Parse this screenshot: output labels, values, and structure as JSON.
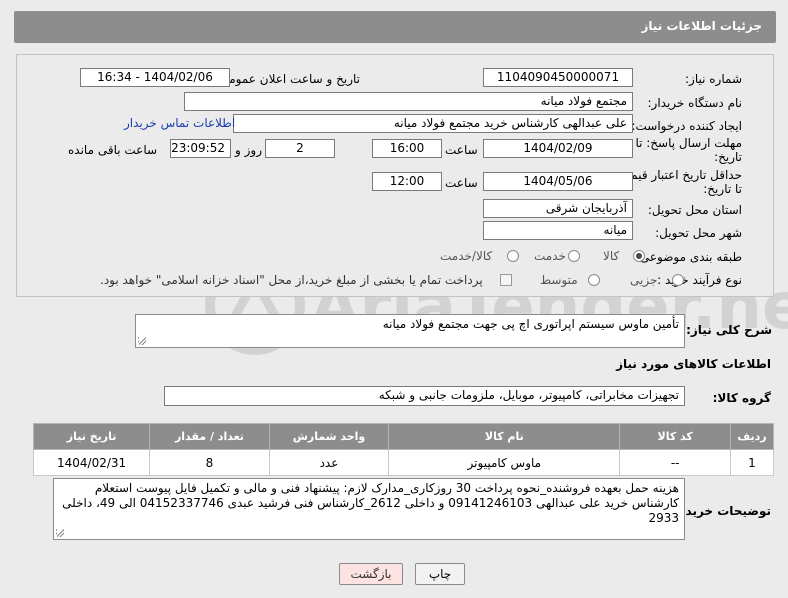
{
  "header": {
    "title": "جزئیات اطلاعات نیاز"
  },
  "form": {
    "need_number_label": "شماره نیاز:",
    "need_number": "1104090450000071",
    "announce_label": "تاریخ و ساعت اعلان عمومی:",
    "announce_value": "1404/02/06 - 16:34",
    "buyer_org_label": "نام دستگاه خریدار:",
    "buyer_org": "مجتمع فولاد میانه",
    "requester_label": "ایجاد کننده درخواست:",
    "requester": "علی عبدالهی کارشناس خرید مجتمع فولاد میانه",
    "contact_link": "اطلاعات تماس خریدار",
    "reply_deadline_label_1": "مهلت ارسال پاسخ: تا",
    "reply_deadline_label_2": "تاریخ:",
    "reply_date": "1404/02/09",
    "time_label": "ساعت",
    "reply_time": "16:00",
    "days_value": "2",
    "days_label": "روز و",
    "remaining_time": "23:09:52",
    "remaining_label": "ساعت باقی مانده",
    "price_validity_label_1": "حداقل تاریخ اعتبار قیمت:",
    "price_validity_label_2": "تا تاریخ:",
    "price_date": "1404/05/06",
    "price_time": "12:00",
    "province_label": "استان محل تحویل:",
    "province": "آذربایجان شرقی",
    "city_label": "شهر محل تحویل:",
    "city": "میانه",
    "category_label": "طبقه بندی موضوعی:",
    "category_options": [
      "کالا",
      "خدمت",
      "کالا/خدمت"
    ],
    "process_label": "نوع فرآیند خرید :",
    "process_options": [
      "جزیی",
      "متوسط"
    ],
    "payment_text": "پرداخت تمام یا بخشی از مبلغ خرید،از محل \"اسناد خزانه اسلامی\" خواهد بود."
  },
  "description": {
    "label": "شرح کلی نیاز:",
    "value": "تأمین ماوس سیستم اپراتوری اچ پی جهت مجتمع فولاد میانه"
  },
  "goods_section": {
    "title": "اطلاعات کالاهای مورد نیاز",
    "group_label": "گروه کالا:",
    "group_value": "تجهیزات مخابراتی، کامپیوتر، موبایل، ملزومات جانبی و شبکه"
  },
  "table": {
    "headers": [
      "ردیف",
      "کد کالا",
      "نام کالا",
      "واحد شمارش",
      "تعداد / مقدار",
      "تاریخ نیاز"
    ],
    "rows": [
      [
        "1",
        "--",
        "ماوس کامپیوتر",
        "عدد",
        "8",
        "1404/02/31"
      ]
    ]
  },
  "buyer_notes": {
    "label": "توضیحات خریدار:",
    "value": "هزینه حمل بعهده فروشنده_نحوه پرداخت 30 روزکاری_مدارک لازم: پیشنهاد فنی و مالی و تکمیل فایل پیوست استعلام کارشناس خرید علی عبدالهی 09141246103 و داخلی 2612_کارشناس فنی فرشید عبدی 04152337746 الی 49، داخلی 2933"
  },
  "buttons": {
    "print": "چاپ",
    "back": "بازگشت"
  },
  "watermark": {
    "text": "AriaTender.neT"
  }
}
